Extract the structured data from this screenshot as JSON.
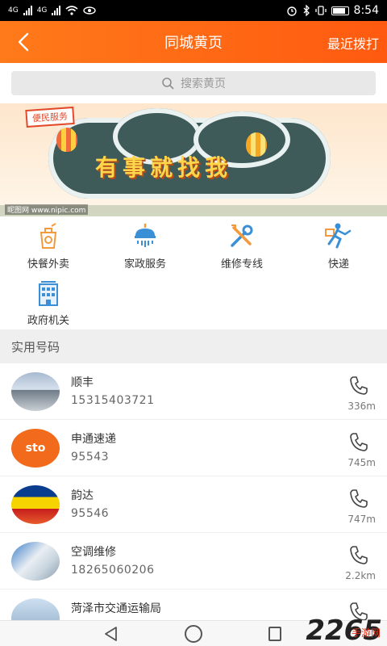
{
  "status_bar": {
    "network_left": "4G",
    "network_right": "4G",
    "time": "8:54"
  },
  "header": {
    "title": "同城黄页",
    "action_label": "最近拨打",
    "back_icon": "chevron-left-icon",
    "background": "#ff6a14"
  },
  "search": {
    "placeholder": "搜索黄页"
  },
  "banner": {
    "tag": "便民服务",
    "slogan": "有事就找我",
    "footer": "昵图网 www.nipic.com"
  },
  "categories": [
    {
      "label": "快餐外卖",
      "icon": "takeout-bag-icon"
    },
    {
      "label": "家政服务",
      "icon": "shower-icon"
    },
    {
      "label": "维修专线",
      "icon": "tools-icon"
    },
    {
      "label": "快递",
      "icon": "courier-icon"
    },
    {
      "label": "政府机关",
      "icon": "building-icon"
    }
  ],
  "section_title": "实用号码",
  "contacts": [
    {
      "name": "顺丰",
      "phone": "15315403721",
      "distance": "336m"
    },
    {
      "name": "申通速递",
      "phone": "95543",
      "distance": "745m",
      "avatar_text": "sto"
    },
    {
      "name": "韵达",
      "phone": "95546",
      "distance": "747m"
    },
    {
      "name": "空调维修",
      "phone": "18265060206",
      "distance": "2.2km"
    },
    {
      "name": "菏泽市交通运输局",
      "phone": "",
      "distance": ""
    }
  ],
  "watermark": {
    "main": "2265",
    "sub": "手游网"
  },
  "colors": {
    "accent": "#ff6a14",
    "icon_blue": "#3a8fd6",
    "icon_orange": "#f39a3c"
  }
}
